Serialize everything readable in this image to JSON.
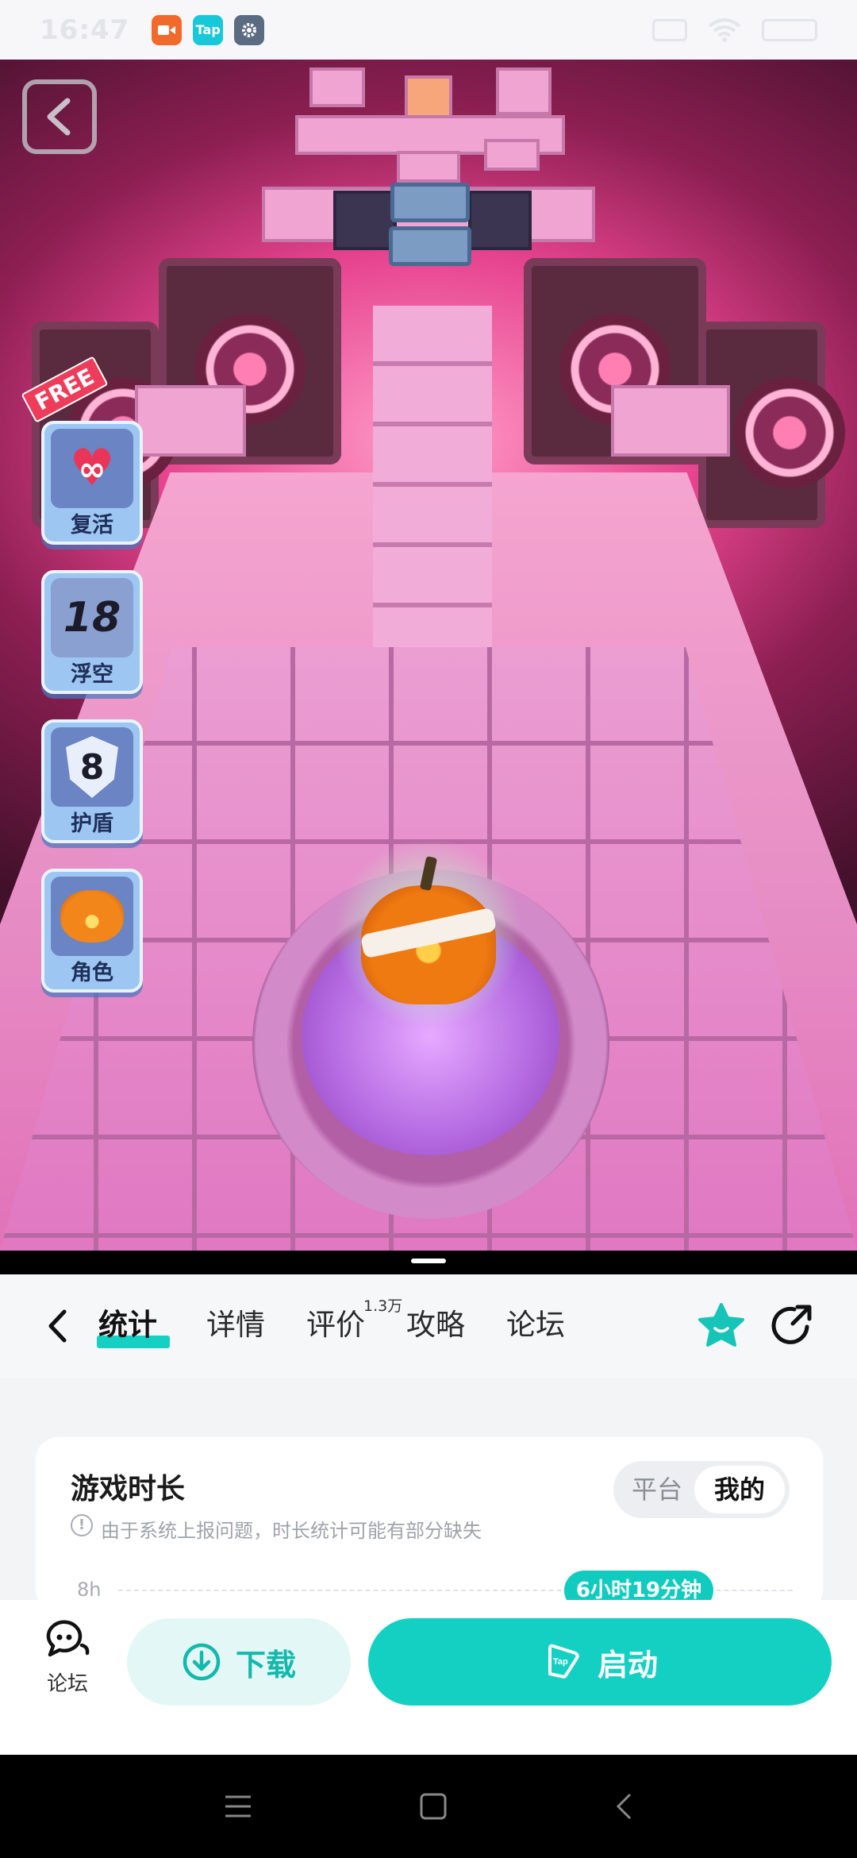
{
  "status_bar": {
    "time": "16:47",
    "apps": [
      {
        "icon": "video-icon",
        "color": "#f26a2b",
        "label": ""
      },
      {
        "icon": "taptap-icon",
        "color": "#17c8d8",
        "label": "Tap"
      },
      {
        "icon": "gear-icon",
        "color": "#5b6b82",
        "label": ""
      }
    ],
    "right_icons": [
      "sim-icon",
      "wifi-icon",
      "battery-icon"
    ]
  },
  "game": {
    "powerups": [
      {
        "label": "复活",
        "tag": "FREE",
        "icon": "heart-infinity-icon",
        "art": "∞"
      },
      {
        "label": "浮空",
        "icon": "float-icon",
        "art": "18"
      },
      {
        "label": "护盾",
        "icon": "shield-icon",
        "art": "8"
      },
      {
        "label": "角色",
        "icon": "pumpkin-icon",
        "art": ""
      }
    ]
  },
  "tabs": {
    "items": [
      "统计",
      "详情",
      "评价",
      "攻略",
      "论坛"
    ],
    "active": "统计",
    "review_count": "1.3万"
  },
  "stats_card": {
    "title": "游戏时长",
    "note": "由于系统上报问题，时长统计可能有部分缺失",
    "toggle": {
      "options": [
        "平台",
        "我的"
      ],
      "selected": "我的"
    },
    "axis_label": "8h",
    "my_duration": "6小时19分钟"
  },
  "action_bar": {
    "forum_label": "论坛",
    "download_label": "下载",
    "launch_label": "启动"
  },
  "colors": {
    "accent": "#14d0c3",
    "accent_light": "#e3f8f6"
  }
}
